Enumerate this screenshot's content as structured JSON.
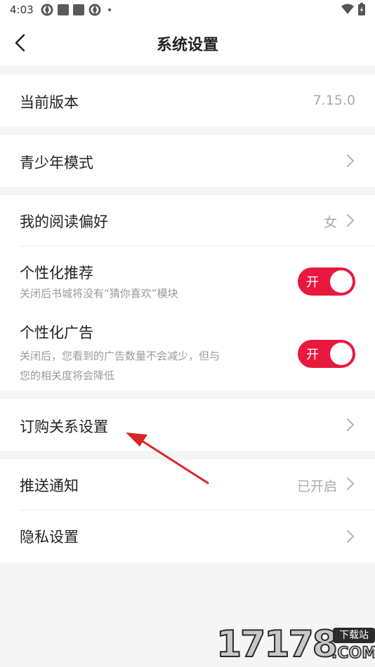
{
  "status_bar": {
    "time": "4:03"
  },
  "nav": {
    "title": "系统设置"
  },
  "settings": {
    "version": {
      "label": "当前版本",
      "value": "7.15.0"
    },
    "youth_mode": {
      "label": "青少年模式"
    },
    "reading_pref": {
      "label": "我的阅读偏好",
      "value": "女"
    },
    "personalized_rec": {
      "label": "个性化推荐",
      "desc": "关闭后书城将没有“猜你喜欢”模块",
      "toggle_text": "开",
      "enabled": true
    },
    "personalized_ads": {
      "label": "个性化广告",
      "desc_line1": "关闭后，您看到的广告数量不会减少，但与",
      "desc_line2": "您的相关度将会降低",
      "toggle_text": "开",
      "enabled": true
    },
    "subscription": {
      "label": "订购关系设置"
    },
    "push": {
      "label": "推送通知",
      "value": "已开启"
    },
    "privacy": {
      "label": "隐私设置"
    }
  },
  "colors": {
    "accent": "#e8183f",
    "annotation_arrow": "#d9252a"
  },
  "watermark": {
    "number": "17178",
    "badge": "下载站",
    "suffix": ".COM"
  }
}
